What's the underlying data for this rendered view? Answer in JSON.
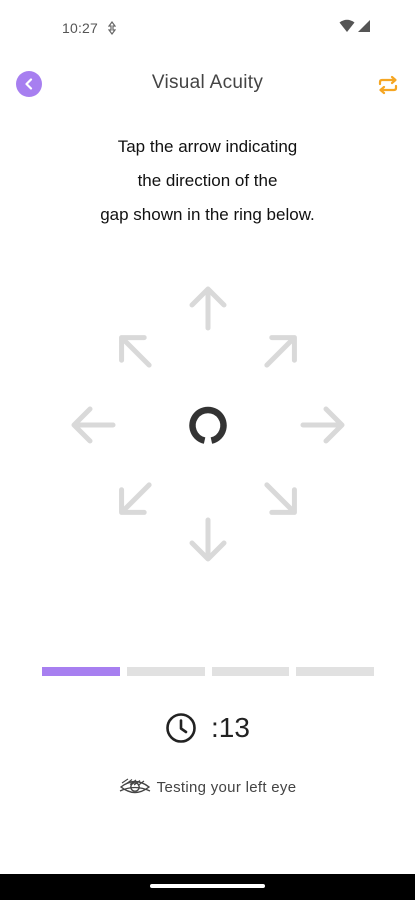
{
  "status_bar": {
    "time": "10:27"
  },
  "header": {
    "title": "Visual Acuity"
  },
  "instruction": {
    "lines": [
      "Tap the arrow indicating",
      "the direction of the",
      "gap shown in the ring below."
    ]
  },
  "arrows": [
    "up",
    "up-right",
    "right",
    "down-right",
    "down",
    "down-left",
    "left",
    "up-left"
  ],
  "progress": {
    "total_segments": 4,
    "completed_segments": 1
  },
  "timer": {
    "text": ":13"
  },
  "eye_status": {
    "text": "Testing your left eye"
  },
  "colors": {
    "accent": "#a77ff0",
    "swap_icon": "#f5a623",
    "arrow": "#d9d9d9",
    "ring": "#333333"
  }
}
